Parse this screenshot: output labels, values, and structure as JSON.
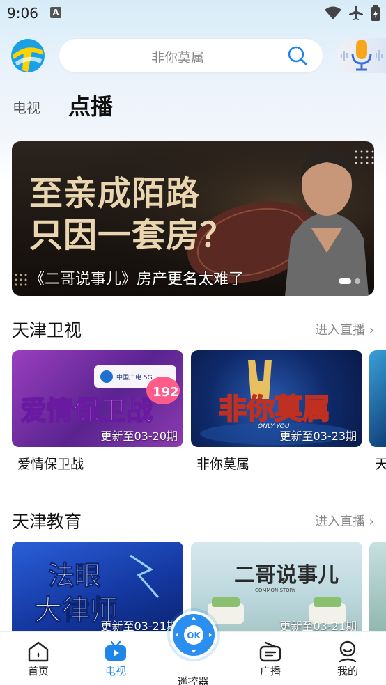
{
  "status_bar": {
    "time": "9:06",
    "notif_letter": "A"
  },
  "search": {
    "placeholder": "非你莫属"
  },
  "channel_tabs": [
    {
      "label": "电视",
      "active": false
    },
    {
      "label": "点播",
      "active": true
    }
  ],
  "banner": {
    "headline_line1": "至亲成陌路",
    "headline_line2": "只因一套房？",
    "caption": "《二哥说事儿》房产更名太难了",
    "page_count": 2,
    "active_page": 1
  },
  "sections": [
    {
      "title": "天津卫视",
      "more": "进入直播",
      "cards": [
        {
          "art_text": "爱情保卫战",
          "update": "更新至03-20期",
          "title": "爱情保卫战",
          "badge": "192",
          "brand": "中国广电 5G"
        },
        {
          "art_text": "非你莫属",
          "update": "更新至03-23期",
          "title": "非你莫属",
          "sub_art": "ONLY YOU"
        }
      ],
      "peek_title": "天"
    },
    {
      "title": "天津教育",
      "more": "进入直播",
      "cards": [
        {
          "art_text_1": "法眼",
          "art_text_2": "大律师",
          "update": "更新至03-21期"
        },
        {
          "art_text": "二哥说事儿",
          "sub_art": "COMMON STORY",
          "update": "更新至03-21期"
        }
      ]
    }
  ],
  "bottom_nav": {
    "items": [
      {
        "label": "首页",
        "icon": "home-icon",
        "active": false
      },
      {
        "label": "电视",
        "icon": "tv-icon",
        "active": true
      },
      {
        "label": "遥控器",
        "icon": "remote-icon",
        "active": false
      },
      {
        "label": "广播",
        "icon": "radio-icon",
        "active": false
      },
      {
        "label": "我的",
        "icon": "profile-icon",
        "active": false
      }
    ],
    "remote_ok": "OK"
  },
  "colors": {
    "accent": "#1e86e8",
    "banner_text": "#e9d6b0"
  }
}
